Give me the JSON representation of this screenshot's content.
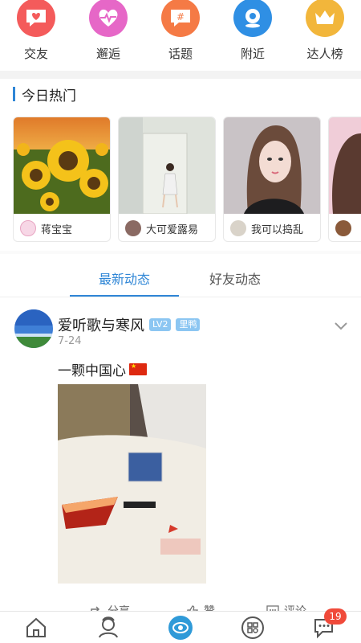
{
  "categories": [
    {
      "label": "交友",
      "icon": "heart-chat-icon",
      "color": "#f45b5b"
    },
    {
      "label": "邂逅",
      "icon": "heartbeat-icon",
      "color": "#e667c7"
    },
    {
      "label": "话题",
      "icon": "hashtag-icon",
      "color": "#f57a45"
    },
    {
      "label": "附近",
      "icon": "location-icon",
      "color": "#2f8fe4"
    },
    {
      "label": "达人榜",
      "icon": "crown-icon",
      "color": "#f2b63b"
    }
  ],
  "hot": {
    "title": "今日热门",
    "cards": [
      {
        "name": "蒋宝宝"
      },
      {
        "name": "大可爱露易"
      },
      {
        "name": "我可以捣乱"
      },
      {
        "name": ""
      }
    ]
  },
  "tabs": {
    "latest": "最新动态",
    "friends": "好友动态"
  },
  "post": {
    "username": "爱听歌与寒风",
    "level": "LV2",
    "tag": "里鸭",
    "time": "7-24",
    "text": "一颗中国心"
  },
  "actions": {
    "share": "分享",
    "like": "赞",
    "comment": "评论"
  },
  "nav": {
    "messages_badge": "19"
  },
  "colors": {
    "accent": "#2f86d6",
    "badge_red": "#f04a3a",
    "level_badge": "#8cc6f2",
    "tag_badge": "#8cc6f2"
  }
}
